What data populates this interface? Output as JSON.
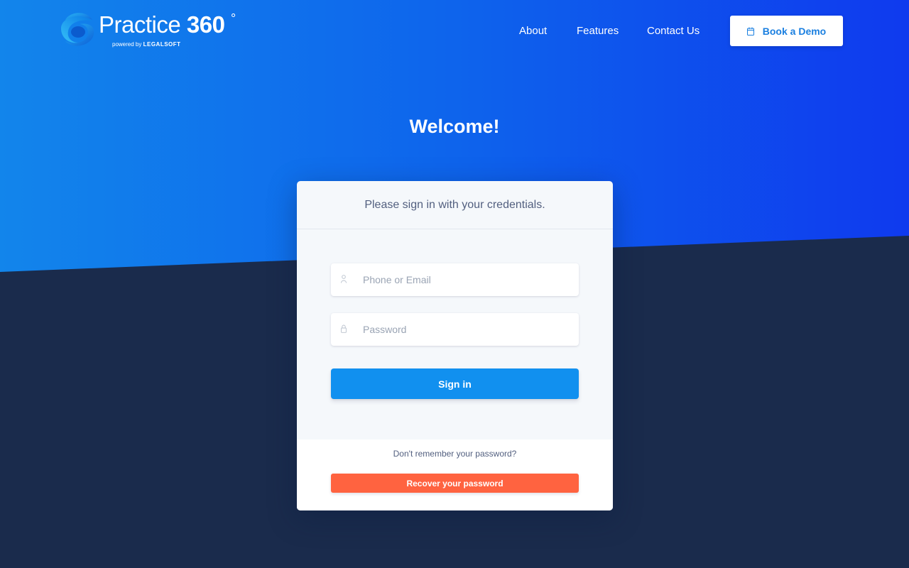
{
  "brand": {
    "name": "Practice",
    "number": "360",
    "degree": "°",
    "powered_by_prefix": "powered by",
    "powered_by_company": "LEGALSOFT"
  },
  "nav": {
    "links": [
      {
        "label": "About"
      },
      {
        "label": "Features"
      },
      {
        "label": "Contact Us"
      }
    ],
    "demo_button": {
      "label": "Book a Demo",
      "icon": "calendar-icon"
    }
  },
  "hero": {
    "title": "Welcome!"
  },
  "login_card": {
    "subtitle": "Please sign in with your credentials.",
    "phone_field": {
      "placeholder": "Phone or Email",
      "value": "",
      "icon": "user-icon"
    },
    "password_field": {
      "placeholder": "Password",
      "value": "",
      "icon": "lock-icon"
    },
    "signin_label": "Sign in",
    "forgot_text": "Don't remember your password?",
    "recover_label": "Recover your password"
  },
  "colors": {
    "hero_gradient_start": "#1285eb",
    "hero_gradient_end": "#0f3aee",
    "dark_background": "#1a2b4c",
    "primary_button": "#1190ef",
    "recover_button": "#ff6340"
  }
}
